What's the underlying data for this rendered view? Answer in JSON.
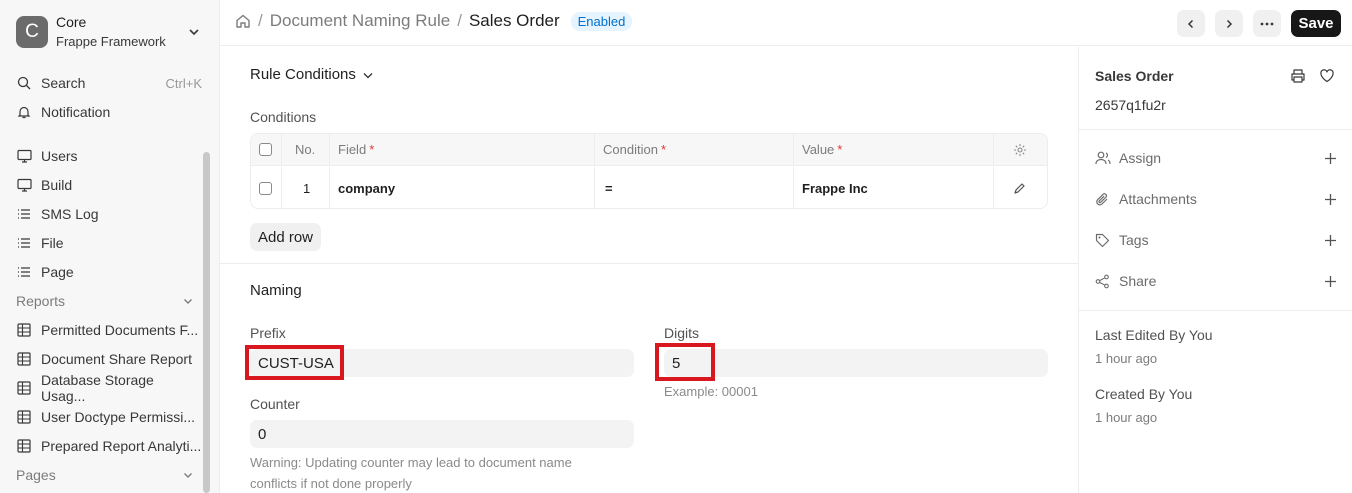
{
  "app": {
    "initial": "C",
    "title": "Core",
    "subtitle": "Frappe Framework"
  },
  "sidebar": {
    "search_label": "Search",
    "search_shortcut": "Ctrl+K",
    "notification_label": "Notification",
    "items": [
      {
        "label": "Users",
        "icon": "monitor-icon"
      },
      {
        "label": "Build",
        "icon": "monitor-icon"
      },
      {
        "label": "SMS Log",
        "icon": "list-icon"
      },
      {
        "label": "File",
        "icon": "list-icon"
      },
      {
        "label": "Page",
        "icon": "list-icon"
      }
    ],
    "reports_label": "Reports",
    "reports": [
      {
        "label": "Permitted Documents F..."
      },
      {
        "label": "Document Share Report"
      },
      {
        "label": "Database Storage Usag..."
      },
      {
        "label": "User Doctype Permissi..."
      },
      {
        "label": "Prepared Report Analyti..."
      }
    ],
    "pages_label": "Pages"
  },
  "header": {
    "breadcrumb_parent": "Document Naming Rule",
    "breadcrumb_separator": "/",
    "title": "Sales Order",
    "status": "Enabled",
    "save_label": "Save"
  },
  "form": {
    "rule_conditions_label": "Rule Conditions",
    "conditions_label": "Conditions",
    "table": {
      "col_no": "No.",
      "col_field": "Field",
      "col_condition": "Condition",
      "col_value": "Value",
      "required_mark": "*",
      "rows": [
        {
          "no": "1",
          "field": "company",
          "condition": "=",
          "value": "Frappe Inc"
        }
      ]
    },
    "add_row_label": "Add row",
    "naming_label": "Naming",
    "prefix_label": "Prefix",
    "prefix_value": "CUST-USA",
    "digits_label": "Digits",
    "digits_value": "5",
    "digits_hint": "Example: 00001",
    "counter_label": "Counter",
    "counter_value": "0",
    "counter_warning": "Warning: Updating counter may lead to document name conflicts if not done properly"
  },
  "side_panel": {
    "doctype": "Sales Order",
    "doc_id": "2657q1fu2r",
    "actions": [
      {
        "label": "Assign",
        "icon": "user-icon"
      },
      {
        "label": "Attachments",
        "icon": "paperclip-icon"
      },
      {
        "label": "Tags",
        "icon": "tag-icon"
      },
      {
        "label": "Share",
        "icon": "share-icon"
      }
    ],
    "last_edited": "Last Edited By You",
    "last_edited_time": "1 hour ago",
    "created": "Created By You",
    "created_time": "1 hour ago"
  },
  "colors": {
    "highlight": "#d8171f",
    "status_text": "#0070cc",
    "status_bg": "#e6f4ff",
    "primary_button": "#171717"
  }
}
